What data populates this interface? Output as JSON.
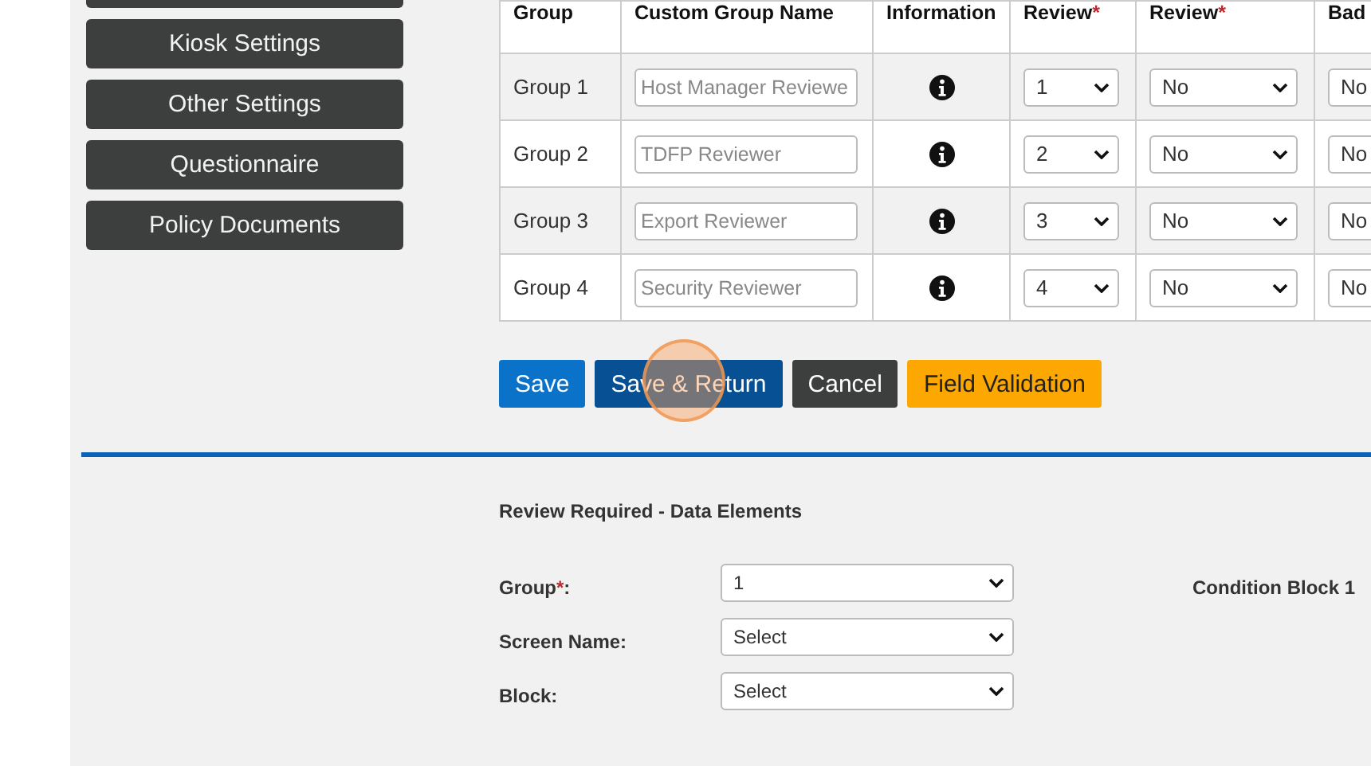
{
  "sidebar": {
    "buttons": [
      "Kiosk Settings",
      "Other Settings",
      "Questionnaire",
      "Policy Documents"
    ]
  },
  "table": {
    "columns": [
      {
        "label": "Group"
      },
      {
        "label": "Custom Group Name"
      },
      {
        "label": "Information"
      },
      {
        "label": "Review",
        "mark": "*"
      },
      {
        "label": "Review",
        "mark": "*"
      },
      {
        "label": "Bad"
      }
    ],
    "rows": [
      {
        "group": "Group 1",
        "placeholder": "Host Manager Reviewe",
        "order": "1",
        "review": "No",
        "column_6": "No"
      },
      {
        "group": "Group 2",
        "placeholder": "TDFP Reviewer",
        "order": "2",
        "review": "No",
        "column_6": "No"
      },
      {
        "group": "Group 3",
        "placeholder": "Export Reviewer",
        "order": "3",
        "review": "No",
        "column_6": "No"
      },
      {
        "group": "Group 4",
        "placeholder": "Security Reviewer",
        "order": "4",
        "review": "No",
        "column_6": "No"
      }
    ]
  },
  "actions": [
    {
      "label": "Save",
      "kind": "primary"
    },
    {
      "label": "Save & Return",
      "kind": "dark"
    },
    {
      "label": "Cancel",
      "kind": "secondary"
    },
    {
      "label": "Field Validation",
      "kind": "warning"
    }
  ],
  "section": {
    "title": "Review Required - Data Elements",
    "condition_label": "Condition Block 1",
    "fields": [
      {
        "label": "Group",
        "mark": "*",
        "suffix": ":",
        "value": "1"
      },
      {
        "label": "Screen Name:",
        "value": "Select"
      },
      {
        "label": "Block:",
        "value": "Select"
      }
    ]
  }
}
